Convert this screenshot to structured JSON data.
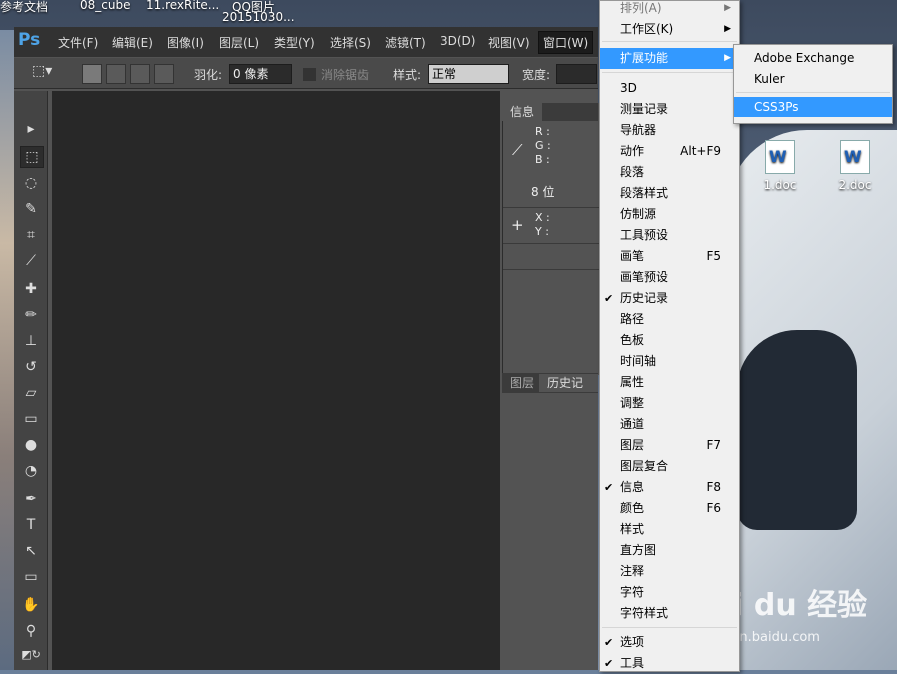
{
  "desktop": {
    "top_labels": [
      "参考文档",
      "08_cube",
      "11.rexRite...",
      "QQ图片",
      "20151030..."
    ],
    "icons": [
      {
        "label": "1.doc"
      },
      {
        "label": "2.doc"
      }
    ],
    "watermark": {
      "brand": "Bai du 经验",
      "url": "jingyan.baidu.com"
    }
  },
  "ps": {
    "logo": "Ps",
    "menus": [
      "文件(F)",
      "编辑(E)",
      "图像(I)",
      "图层(L)",
      "类型(Y)",
      "选择(S)",
      "滤镜(T)",
      "3D(D)",
      "视图(V)",
      "窗口(W)"
    ],
    "options": {
      "feather_label": "羽化:",
      "feather_value": "0 像素",
      "antialias_label": "消除锯齿",
      "style_label": "样式:",
      "style_value": "正常",
      "width_label": "宽度:"
    },
    "info_panel": {
      "tab": "信息",
      "r": "R :",
      "g": "G :",
      "b": "B :",
      "bits": "8 位",
      "x": "X :",
      "y": "Y :"
    },
    "history_tabs": [
      "图层",
      "历史记录"
    ]
  },
  "window_menu": {
    "items": [
      {
        "label": "排列(A)",
        "arrow": true,
        "disabled": true
      },
      {
        "label": "工作区(K)",
        "arrow": true
      },
      {
        "label": "扩展功能",
        "arrow": true,
        "highlight": true
      },
      {
        "label": "3D"
      },
      {
        "label": "测量记录"
      },
      {
        "label": "导航器"
      },
      {
        "label": "动作",
        "shortcut": "Alt+F9"
      },
      {
        "label": "段落"
      },
      {
        "label": "段落样式"
      },
      {
        "label": "仿制源"
      },
      {
        "label": "工具预设"
      },
      {
        "label": "画笔",
        "shortcut": "F5"
      },
      {
        "label": "画笔预设"
      },
      {
        "label": "历史记录",
        "checked": true
      },
      {
        "label": "路径"
      },
      {
        "label": "色板"
      },
      {
        "label": "时间轴"
      },
      {
        "label": "属性"
      },
      {
        "label": "调整"
      },
      {
        "label": "通道"
      },
      {
        "label": "图层",
        "shortcut": "F7"
      },
      {
        "label": "图层复合"
      },
      {
        "label": "信息",
        "shortcut": "F8",
        "checked": true
      },
      {
        "label": "颜色",
        "shortcut": "F6"
      },
      {
        "label": "样式"
      },
      {
        "label": "直方图"
      },
      {
        "label": "注释"
      },
      {
        "label": "字符"
      },
      {
        "label": "字符样式"
      },
      {
        "label": "选项",
        "checked": true
      },
      {
        "label": "工具",
        "checked": true
      }
    ]
  },
  "ext_submenu": {
    "items": [
      {
        "label": "Adobe Exchange"
      },
      {
        "label": "Kuler"
      },
      {
        "label": "CSS3Ps",
        "highlight": true
      }
    ]
  }
}
